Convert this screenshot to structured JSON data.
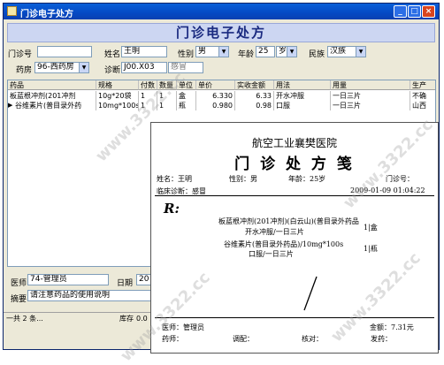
{
  "window": {
    "title": "门诊电子处方",
    "min": "_",
    "max": "□",
    "close": "×"
  },
  "banner": "门诊电子处方",
  "form": {
    "clinic_no_label": "门诊号",
    "clinic_no_value": "",
    "name_label": "姓名",
    "name_value": "王明",
    "gender_label": "性别",
    "gender_value": "男",
    "age_label": "年龄",
    "age_value": "25",
    "age_unit": "岁",
    "ethnic_label": "民族",
    "ethnic_value": "汉族",
    "pharmacy_label": "药房",
    "pharmacy_value": "96-西药房",
    "diagnosis_label": "诊断",
    "diagnosis_code": "J00.X03",
    "diagnosis_text": "感冒"
  },
  "grid": {
    "columns": [
      "药品",
      "规格",
      "付数",
      "数量",
      "单位",
      "单价",
      "实收金额",
      "用法",
      "用量",
      "生产"
    ],
    "rows": [
      [
        "板蓝根冲剂(201冲剂",
        "10g*20袋",
        "1",
        "1",
        "盒",
        "6.330",
        "6.33",
        "开水冲服",
        "一日三片",
        "不确"
      ],
      [
        "谷维素片(普目录外药",
        "10mg*100s",
        "1",
        "1",
        "瓶",
        "0.980",
        "0.98",
        "口服",
        "一日三片",
        "山西"
      ]
    ]
  },
  "bottom": {
    "doctor_label": "医师",
    "doctor_value": "74-管理员",
    "date_label": "日期",
    "date_value": "20",
    "summary_label": "摘要",
    "summary_value": "请注意药品的使用说明"
  },
  "status": {
    "left": "一共 2 条...",
    "stock_label": "库存",
    "stock_value": "0.0"
  },
  "paper": {
    "hospital": "航空工业襄樊医院",
    "title": "门 诊 处 方 笺",
    "name": "姓名：王明",
    "gender": "性别：男",
    "age": "年龄：25岁",
    "clinic_no": "门诊号：",
    "diagnosis": "临床诊断：感冒",
    "datetime": "2009-01-09 01:04:22",
    "rp": "R:",
    "items": [
      {
        "line1": "板蓝根冲剂(201冲剂)(白云山)(普目录外药品",
        "line2": "开水冲服/一日三片",
        "qty": "1|盒"
      },
      {
        "line1": "谷维素片(普目录外药品)/10mg*100s",
        "line2": "口服/一日三片",
        "qty": "1|瓶"
      }
    ],
    "doctor": "医师：管理员",
    "amount": "金额：7.31元",
    "pharmacist": "药师：",
    "dispense": "调配：",
    "check": "核对：",
    "issue": "发药："
  },
  "watermark": "www.3322.cc"
}
